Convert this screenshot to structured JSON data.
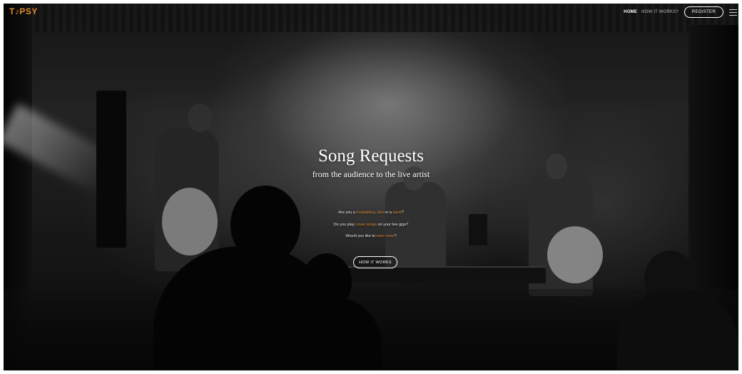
{
  "header": {
    "logo": {
      "part1": "T",
      "part2": "PSY"
    },
    "nav": {
      "home": "HOME",
      "how_it_works": "HOW IT WORKS?",
      "register": "REGISTER"
    }
  },
  "hero": {
    "title": "Song Requests",
    "subtitle": "from the audience to the live artist",
    "line1": {
      "prefix": "Are you a ",
      "link1": "troubadour",
      "sep1": ", ",
      "link2": "duo",
      "sep2": " or a ",
      "link3": "band",
      "suffix": "?"
    },
    "line2": {
      "prefix": "Do you play ",
      "link": "cover songs",
      "suffix": " on your live gigs?"
    },
    "line3": {
      "prefix": "Would you like to ",
      "link": "earn more",
      "suffix": "?"
    },
    "cta": "HOW IT WORKS"
  },
  "colors": {
    "accent": "#e08a2e",
    "text": "#ffffff",
    "background": "#0c0c0c"
  },
  "icons": {
    "menu": "hamburger-menu-icon",
    "logo_dot": "music-note-icon"
  }
}
